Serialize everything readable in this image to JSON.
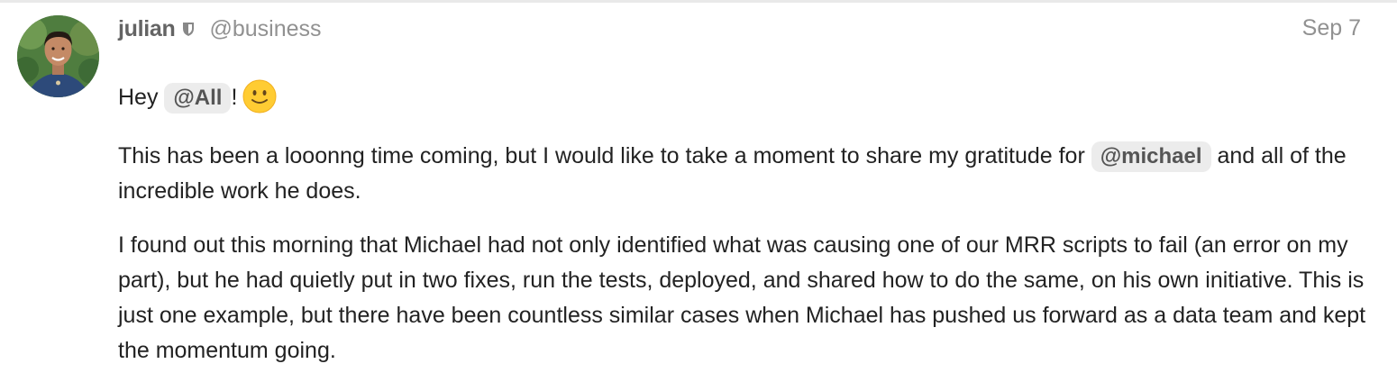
{
  "post": {
    "username": "julian",
    "handle": "@business",
    "date": "Sep 7",
    "paragraphs": {
      "p1": {
        "text_before": "Hey ",
        "mention": "@All",
        "text_after": "!",
        "emoji": "slightly-smiling-face"
      },
      "p2": {
        "text_before": "This has been a looonng time coming, but I would like to take a moment to share my gratitude for ",
        "mention": "@michael",
        "text_after": " and all of the incredible work he does."
      },
      "p3": {
        "text": "I found out this morning that Michael had not only identified what was causing one of our MRR scripts to fail (an error on my part), but he had quietly put in two fixes, run the tests, deployed, and shared how to do the same, on his own initiative. This is just one example, but there have been countless similar cases when Michael has pushed us forward as a data team and kept the momentum going."
      }
    }
  },
  "icons": {
    "user_badge": "shield-icon",
    "emoji": "slightly-smiling-face-icon"
  },
  "colors": {
    "mention_bg": "#ececec",
    "username": "#646464",
    "meta_text": "#919191",
    "body_text": "#222222",
    "emoji_face": "#ffcc33"
  }
}
